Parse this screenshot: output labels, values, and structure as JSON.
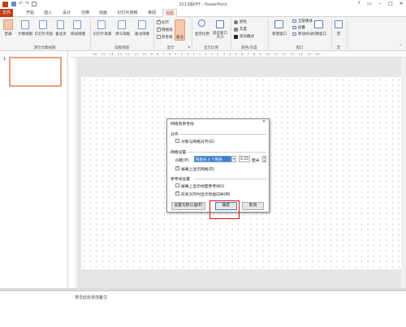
{
  "window": {
    "title": "2013版PPT - PowerPoint",
    "controls": [
      "?",
      "▭",
      "–",
      "□",
      "✕"
    ]
  },
  "tabs": [
    "文件",
    "开始",
    "插入",
    "设计",
    "切换",
    "动画",
    "幻灯片放映",
    "审阅",
    "视图"
  ],
  "ribbon": {
    "views": [
      "普通",
      "大纲视图",
      "幻灯片浏览",
      "备注页",
      "阅读视图"
    ],
    "master": [
      "幻灯片母版",
      "讲义母版",
      "备注母版"
    ],
    "show_checks": [
      {
        "label": "标尺",
        "checked": true
      },
      {
        "label": "网格线",
        "checked": true
      },
      {
        "label": "参考线",
        "checked": false
      }
    ],
    "notes_btn": "备注",
    "zoom": [
      "显示比例",
      "适应窗口大小"
    ],
    "color": [
      "颜色",
      "灰度",
      "黑白模式"
    ],
    "new_window": "新建窗口",
    "window_items": [
      "全部重排",
      "层叠",
      "移动拆分"
    ],
    "switch_window": "切换窗口",
    "macro": "宏",
    "groups": [
      "演示文稿视图",
      "母版视图",
      "显示",
      "显示比例",
      "颜色/灰度",
      "窗口",
      "宏"
    ]
  },
  "ruler_ticks": "16 · 15 · 14 · 13 · 12 · 11 · 10 · 9 · 8 · 7 · 6 · 5 · 4 · 3 · 2 · 1 · 0 · 1 · 2 · 3 · 4 · 5 · 6 · 7 · 8 · 9 · 10 · 11 · 12 · 13 · 14 · 15 · 16",
  "slide_number": "1",
  "notes_placeholder": "单击此处添加备注",
  "dialog": {
    "title": "网格和参考线",
    "align_section": "对齐",
    "snap_label": "对象与网格对齐(G)",
    "grid_section": "网格设置",
    "spacing_label": "间距(P):",
    "spacing_value": "每厘米 4 个网格",
    "spacing_number": "0.25",
    "spacing_unit": "厘米",
    "show_grid_label": "屏幕上显示网格(D)",
    "guides_section": "参考线设置",
    "show_guides_label": "屏幕上显示绘图参考线(I)",
    "smart_guides_label": "形状对齐时显示智能向导(M)",
    "default_button": "设置为默认值(E)",
    "ok_button": "确定",
    "cancel_button": "取消",
    "snap_checked": false,
    "show_grid_checked": true,
    "show_guides_checked": false,
    "smart_guides_checked": true
  }
}
